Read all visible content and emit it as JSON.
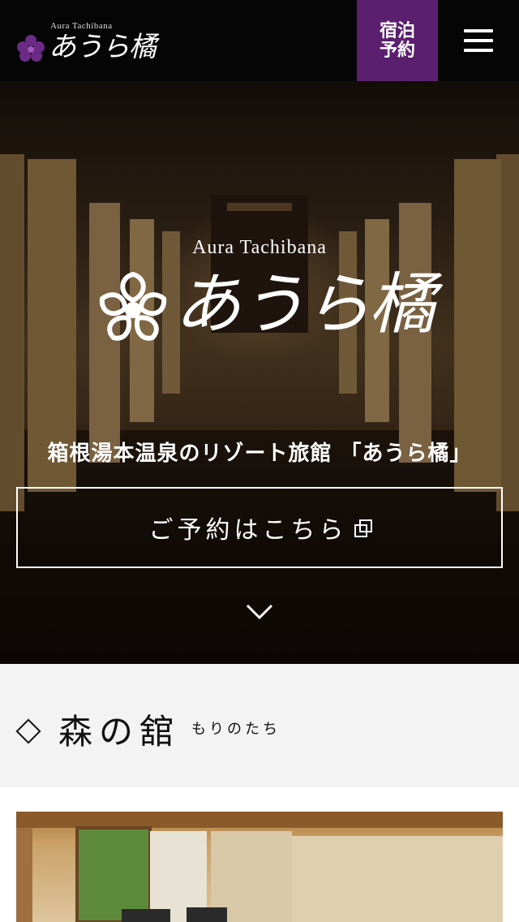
{
  "header": {
    "logo_small": "Aura Tachibana",
    "logo_big": "あうら橘",
    "reserve_label_line1": "宿泊",
    "reserve_label_line2": "予約",
    "menu_icon": "hamburger-icon",
    "accent_color": "#5a1f6e"
  },
  "hero": {
    "title_small": "Aura Tachibana",
    "title_big": "あうら橘",
    "subtitle": "箱根湯本温泉のリゾート旅館 「あうら橘」",
    "cta_label": "ご予約はこちら",
    "cta_icon": "external-link-icon",
    "scroll_icon": "chevron-down-icon"
  },
  "section": {
    "title": "森の舘",
    "reading": "もりのたち",
    "bullet_icon": "diamond-icon"
  }
}
